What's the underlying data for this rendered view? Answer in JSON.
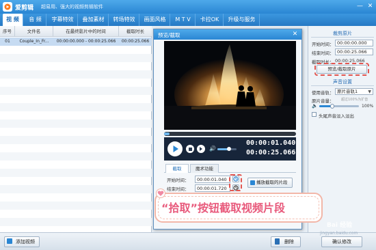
{
  "titlebar": {
    "app_name": "爱剪辑",
    "slogan": "超易用、强大的视频剪辑软件",
    "minimize": "—",
    "close": "✕",
    "colors": {
      "bar_top": "#4ea9ea",
      "bar_bottom": "#2a86d3"
    }
  },
  "tabs": [
    {
      "label": "视 频",
      "active": true
    },
    {
      "label": "音 频"
    },
    {
      "label": "字幕特效"
    },
    {
      "label": "叠加素材"
    },
    {
      "label": "转场特效"
    },
    {
      "label": "画面风格"
    },
    {
      "label": "M T V"
    },
    {
      "label": "卡拉OK"
    },
    {
      "label": "升级与服务"
    }
  ],
  "video_list": {
    "columns": [
      "序号",
      "文件名",
      "在最终影片中的时间",
      "截取时长"
    ],
    "rows": [
      {
        "index": "01",
        "filename": "Couple_In_Fr...",
        "time_range": "00:00:00.000 - 00:00:25.066",
        "duration": "00:00:25.066"
      }
    ]
  },
  "bottom": {
    "add_video": "添加视频",
    "delete": "删除",
    "confirm_edit": "确认修改"
  },
  "right_panel": {
    "clip_section_title": "裁剪原片",
    "start_label": "开始时间：",
    "start_value": "00:00:00.000",
    "end_label": "结束时间：",
    "end_value": "00:00:25.066",
    "duration_label": "截取时长：",
    "duration_value": "00:00:25.066",
    "preview_capture_btn": "预览/截取原片",
    "sound_section_title": "声音设置",
    "audio_track_label": "使用音轨：",
    "audio_track_value": "原片音轨1",
    "volume_label": "原片音量：",
    "volume_hint": "超过100%为扩音",
    "volume_value": "100%",
    "fade_label": "头尾声音淡入淡出"
  },
  "dialog": {
    "title": "预览/截取",
    "current_time": "00:00:01.040",
    "total_time": "00:00:25.066",
    "timeline_progress": 0.04,
    "volume_level": 0.6,
    "tab_capture": "截取",
    "tab_magic": "魔术功能",
    "start_label": "开始时间：",
    "start_value": "00:00:01.040",
    "end_label": "结束时间：",
    "end_value": "00:00:01.720",
    "play_clip": "播放截取的片段"
  },
  "banner": {
    "text": "“拾取”按钮截取视频片段",
    "colors": {
      "text": "#e85a7c",
      "border": "#f2b6a8"
    }
  },
  "watermark": {
    "text": "Bai 经验",
    "url": "jingyan.baidu.com"
  }
}
